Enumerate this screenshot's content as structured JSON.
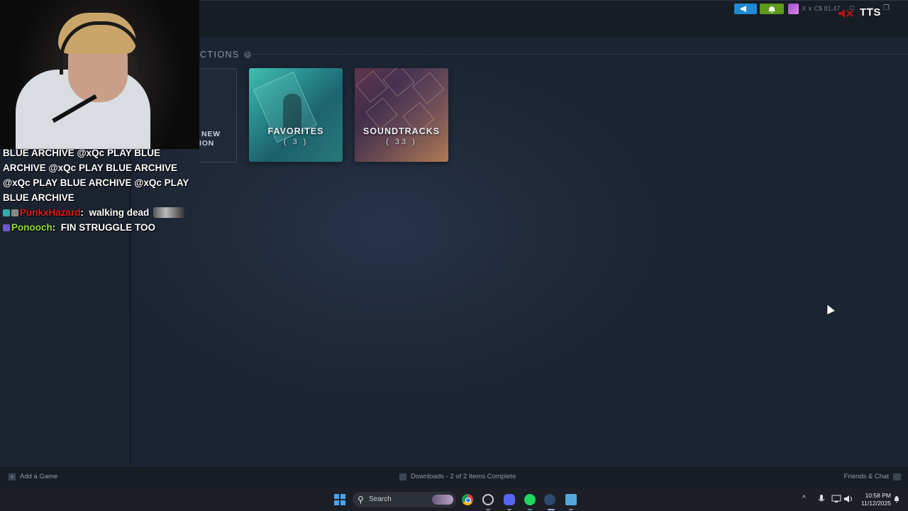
{
  "library": {
    "section_header": "CTIONS",
    "help_badge": "?",
    "new_collection": {
      "line1": "NEW",
      "line2": "ION"
    },
    "collections": [
      {
        "name": "FAVORITES",
        "count": "( 3 )"
      },
      {
        "name": "SOUNDTRACKS",
        "count": "( 33 )"
      }
    ]
  },
  "chat": {
    "lines": [
      "BLUE ARCHIVE @xQc PLAY BLUE",
      "ARCHIVE @xQc PLAY BLUE ARCHIVE",
      "@xQc PLAY BLUE ARCHIVE @xQc PLAY",
      "BLUE ARCHIVE"
    ],
    "messages": [
      {
        "user": "PunkxHazard",
        "text": "walking dead"
      },
      {
        "user": "Ponooch",
        "text": "FIN STRUGGLE TOO"
      }
    ]
  },
  "overlay": {
    "wallet": "X ∨ C$ 81.47",
    "tts": "TTS",
    "window_controls": [
      "□",
      "—",
      "❐"
    ]
  },
  "statusbar": {
    "add_game": "Add a Game",
    "downloads": "Downloads - 2 of 2 Items Complete",
    "friends": "Friends & Chat"
  },
  "taskbar": {
    "search_placeholder": "Search",
    "time": "10:58 PM",
    "date": "11/12/2025",
    "tray_chevron": "^"
  },
  "colors": {
    "steam_bg": "#1e2836",
    "chat_user_red": "#e31b1b",
    "chat_user_green": "#8ee03a"
  }
}
